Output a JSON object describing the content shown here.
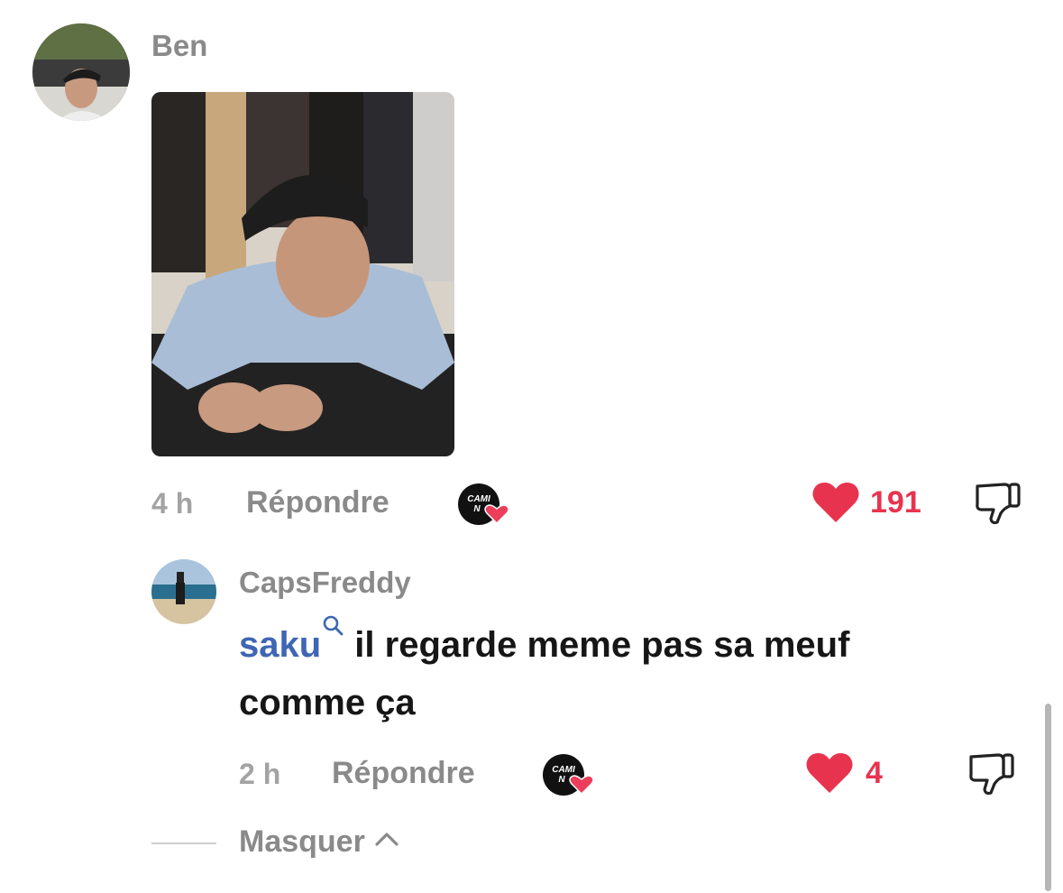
{
  "comments": [
    {
      "username": "Ben",
      "time": "4 h",
      "reply_label": "Répondre",
      "badge_text": "CAMI NO",
      "likes": "191",
      "liked": true,
      "has_photo": true
    },
    {
      "username": "CapsFreddy",
      "mention": "saku",
      "text_line1": " il regarde meme pas sa meuf",
      "text_line2": "comme ça",
      "time": "2 h",
      "reply_label": "Répondre",
      "badge_text": "CAMI NO",
      "likes": "4",
      "liked": true
    }
  ],
  "thread": {
    "hide_label": "Masquer"
  },
  "icons": {
    "like": "heart-icon",
    "dislike": "thumbs-down-icon",
    "mention_search": "search-icon",
    "collapse": "chevron-up-icon"
  },
  "colors": {
    "like": "#e8334f",
    "mention": "#3f66b3",
    "muted": "#8a8a8a"
  }
}
